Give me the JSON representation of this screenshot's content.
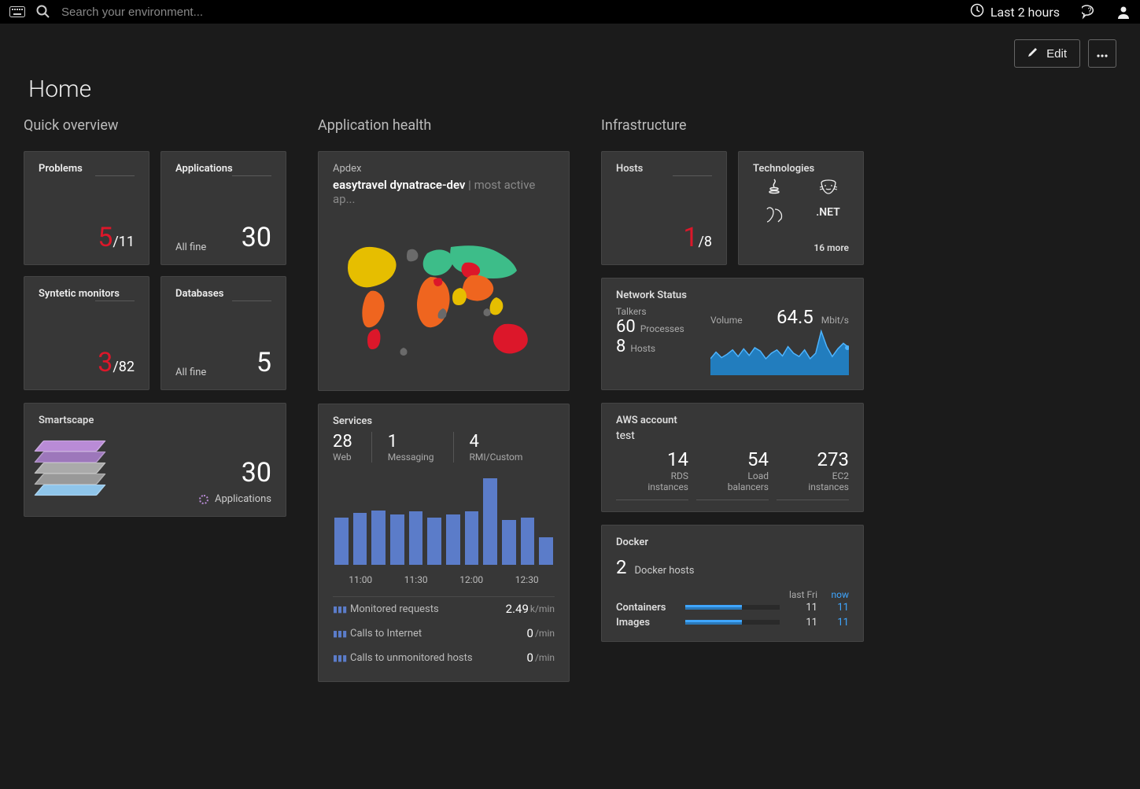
{
  "topbar": {
    "search_placeholder": "Search your environment...",
    "time_range": "Last 2 hours"
  },
  "toolbar": {
    "edit_label": "Edit"
  },
  "page_title": "Home",
  "sections": {
    "overview": "Quick overview",
    "app_health": "Application health",
    "infra": "Infrastructure"
  },
  "overview": {
    "problems": {
      "label": "Problems",
      "num": "5",
      "denom": "/11"
    },
    "applications": {
      "label": "Applications",
      "num": "30",
      "sub": "All fine"
    },
    "synthetic": {
      "label": "Syntetic monitors",
      "num": "3",
      "denom": "/82"
    },
    "databases": {
      "label": "Databases",
      "num": "5",
      "sub": "All fine"
    },
    "smartscape": {
      "label": "Smartscape",
      "num": "30",
      "sub": "Applications"
    }
  },
  "apdex": {
    "label": "Apdex",
    "app_name": "easytravel dynatrace-dev",
    "suffix": "most active ap..."
  },
  "services": {
    "label": "Services",
    "cols": [
      {
        "n": "28",
        "l": "Web"
      },
      {
        "n": "1",
        "l": "Messaging"
      },
      {
        "n": "4",
        "l": "RMI/Custom"
      }
    ],
    "rows": [
      {
        "label": "Monitored requests",
        "value": "2.49",
        "unit": "k/min"
      },
      {
        "label": "Calls to Internet",
        "value": "0",
        "unit": "/min"
      },
      {
        "label": "Calls to unmonitored hosts",
        "value": "0",
        "unit": "/min"
      }
    ]
  },
  "infra": {
    "hosts": {
      "label": "Hosts",
      "num": "1",
      "denom": "/8"
    },
    "tech": {
      "label": "Technologies",
      "more": "16 more",
      "icons": [
        "java",
        "tomcat",
        "db",
        ".NET"
      ]
    },
    "network": {
      "label": "Network Status",
      "talkers_label": "Talkers",
      "processes": {
        "n": "60",
        "l": "Processes"
      },
      "hosts": {
        "n": "8",
        "l": "Hosts"
      },
      "volume_label": "Volume",
      "volume_value": "64.5",
      "volume_unit": "Mbit/s"
    },
    "aws": {
      "label": "AWS account",
      "name": "test",
      "cols": [
        {
          "n": "14",
          "l1": "RDS",
          "l2": "instances"
        },
        {
          "n": "54",
          "l1": "Load",
          "l2": "balancers"
        },
        {
          "n": "273",
          "l1": "EC2",
          "l2": "instances"
        }
      ]
    },
    "docker": {
      "label": "Docker",
      "hosts": {
        "n": "2",
        "l": "Docker hosts"
      },
      "col_last": "last Fri",
      "col_now": "now",
      "rows": [
        {
          "label": "Containers",
          "last": "11",
          "now": "11"
        },
        {
          "label": "Images",
          "last": "11",
          "now": "11"
        }
      ]
    }
  },
  "chart_data": [
    {
      "type": "bar",
      "title": "Services requests",
      "x_ticks": [
        "11:00",
        "11:30",
        "12:00",
        "12:30"
      ],
      "values": [
        55,
        60,
        63,
        58,
        62,
        55,
        58,
        62,
        100,
        52,
        55,
        32
      ],
      "color": "#5b7cc9"
    },
    {
      "type": "area",
      "title": "Network volume",
      "ylabel": "Mbit/s",
      "values": [
        30,
        42,
        32,
        38,
        46,
        34,
        48,
        36,
        50,
        44,
        30,
        40,
        46,
        35,
        52,
        40,
        34,
        46,
        30,
        40,
        80,
        52,
        34,
        48,
        58,
        50
      ],
      "color": "#1f8ad6"
    }
  ]
}
